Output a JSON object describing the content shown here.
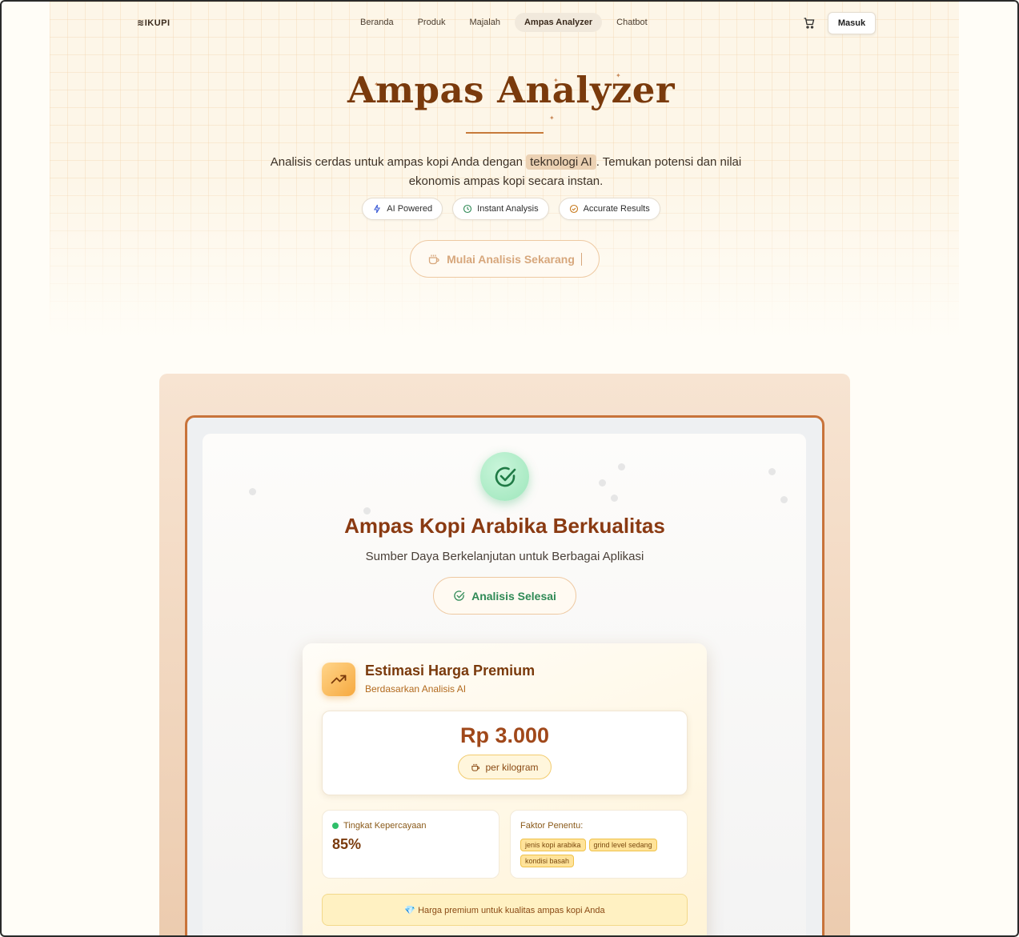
{
  "nav": {
    "logo": "≋IKUPI",
    "links": [
      "Beranda",
      "Produk",
      "Majalah",
      "Ampas Analyzer",
      "Chatbot"
    ],
    "active_index": 3,
    "cart_icon": "cart-icon",
    "login_label": "Masuk"
  },
  "hero": {
    "title": "Ampas Analyzer",
    "desc_before": "Analisis cerdas untuk ampas kopi Anda dengan ",
    "desc_highlight": "teknologi AI",
    "desc_after": ". Temukan potensi dan nilai ekonomis ampas kopi secara instan.",
    "pills": [
      {
        "label": "AI Powered",
        "icon": "sparkle-icon",
        "color": "#3b5bd6"
      },
      {
        "label": "Instant Analysis",
        "icon": "clock-icon",
        "color": "#2f8a56"
      },
      {
        "label": "Accurate Results",
        "icon": "check-circle-icon",
        "color": "#c77a1e"
      }
    ],
    "start_label": "Mulai Analisis Sekarang"
  },
  "result": {
    "title": "Ampas Kopi Arabika Berkualitas",
    "subtitle": "Sumber Daya Berkelanjutan untuk Berbagai Aplikasi",
    "status_label": "Analisis Selesai"
  },
  "price_card": {
    "title": "Estimasi Harga Premium",
    "subtitle": "Berdasarkan Analisis AI",
    "price": "Rp 3.000",
    "unit": "per kilogram",
    "confidence_label": "Tingkat Kepercayaan",
    "confidence_value": "85%",
    "factors_label": "Faktor Penentu:",
    "factors": [
      "jenis kopi arabika",
      "grind level sedang",
      "kondisi basah"
    ],
    "note": "💎 Harga premium untuk kualitas ampas kopi Anda"
  },
  "colors": {
    "accent": "#c8733a",
    "title_brown": "#7a3a0c",
    "success_green": "#2f8a56"
  }
}
